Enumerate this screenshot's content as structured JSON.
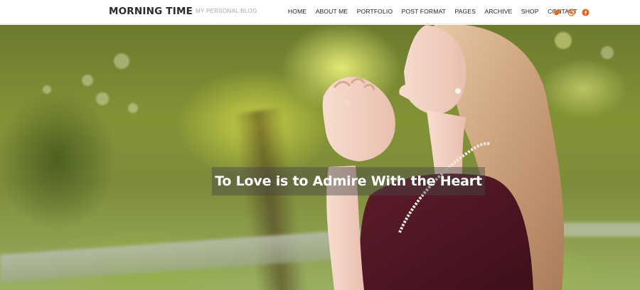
{
  "site": {
    "title": "MORNING TIME",
    "tagline": "MY PERSONAL BLOG"
  },
  "nav": {
    "items": [
      {
        "label": "HOME",
        "name": "nav-home"
      },
      {
        "label": "ABOUT ME",
        "name": "nav-about-me"
      },
      {
        "label": "PORTFOLIO",
        "name": "nav-portfolio"
      },
      {
        "label": "POST FORMAT",
        "name": "nav-post-format"
      },
      {
        "label": "PAGES",
        "name": "nav-pages"
      },
      {
        "label": "ARCHIVE",
        "name": "nav-archive"
      },
      {
        "label": "SHOP",
        "name": "nav-shop"
      },
      {
        "label": "CONTACT",
        "name": "nav-contact"
      }
    ]
  },
  "social": {
    "accent_color": "#e0671f",
    "icons": [
      "twitter-icon",
      "dribbble-icon",
      "facebook-icon"
    ]
  },
  "hero": {
    "headline": "To Love is to Admire With the Heart"
  }
}
